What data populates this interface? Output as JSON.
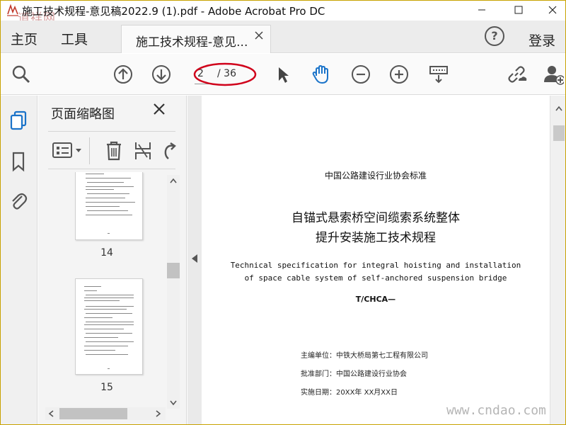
{
  "window": {
    "title": "施工技术规程-意见稿2022.9 (1).pdf - Adobe Acrobat Pro DC",
    "watermark_top": "道祥网",
    "watermark_bottom": "www.cndao.com"
  },
  "tabbar": {
    "home_label": "主页",
    "tools_label": "工具",
    "doc_tab_label": "施工技术规程-意见...",
    "login_label": "登录"
  },
  "toolbar": {
    "current_page": "2",
    "total_pages": "/ 36"
  },
  "thumb_panel": {
    "title": "页面缩略图",
    "pages": [
      {
        "number": "14"
      },
      {
        "number": "15"
      }
    ]
  },
  "document": {
    "org": "中国公路建设行业协会标准",
    "title_line1": "自锚式悬索桥空间缆索系统整体",
    "title_line2": "提升安装施工技术规程",
    "en_line1": "Technical specification for integral hoisting and installation",
    "en_line2": "of space cable system of self-anchored suspension bridge",
    "code": "T/CHCA—",
    "meta": [
      "主编单位：中铁大桥局第七工程有限公司",
      "批准部门：中国公路建设行业协会",
      "实施日期：20XX年 XX月XX日"
    ]
  },
  "colors": {
    "accent_blue": "#1a73c9",
    "annotation_red": "#d0021b"
  }
}
